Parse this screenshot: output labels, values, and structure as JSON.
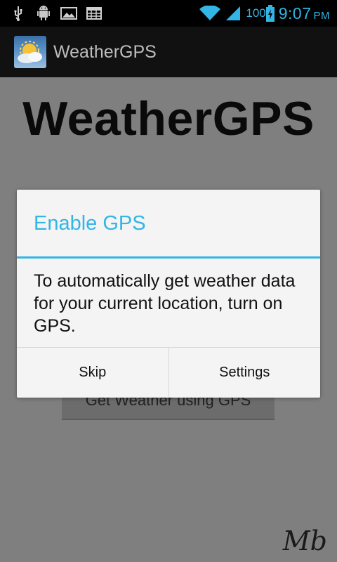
{
  "status_bar": {
    "icons": [
      "usb-icon",
      "android-debug-icon",
      "gallery-icon",
      "calendar-icon"
    ],
    "battery_level": "100",
    "time": "9:07",
    "ampm": "PM"
  },
  "action_bar": {
    "title": "WeatherGPS"
  },
  "content": {
    "heading": "WeatherGPS",
    "gps_button_label": "Get Weather using GPS",
    "signature": "Mb"
  },
  "dialog": {
    "title": "Enable GPS",
    "message": "To automatically get weather data for your current location, turn on GPS.",
    "buttons": {
      "skip": "Skip",
      "settings": "Settings"
    }
  },
  "colors": {
    "accent": "#33b5e5",
    "dim_background": "#7f7f7f",
    "dialog_background": "#f4f4f4"
  }
}
